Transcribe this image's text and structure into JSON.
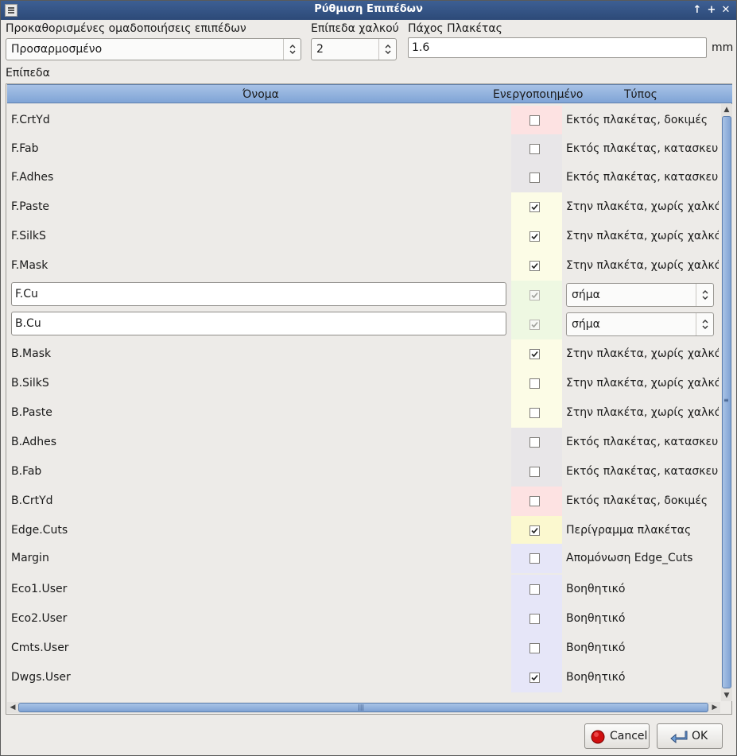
{
  "window": {
    "title": "Ρύθμιση Επιπέδων"
  },
  "presets": {
    "label": "Προκαθορισμένες ομαδοποιήσεις επιπέδων",
    "value": "Προσαρμοσμένο"
  },
  "copper": {
    "label": "Επίπεδα χαλκού",
    "value": "2"
  },
  "thickness": {
    "label": "Πάχος Πλακέτας",
    "value": "1.6",
    "unit": "mm"
  },
  "layers": {
    "label": "Επίπεδα",
    "headers": {
      "name": "Όνομα",
      "enabled": "Ενεργοποιημένο",
      "type": "Τύπος"
    },
    "rows": [
      {
        "name": "F.CrtYd",
        "checked": false,
        "type": "Εκτός πλακέτας, δοκιμές",
        "color": "#fde2e2"
      },
      {
        "name": "F.Fab",
        "checked": false,
        "type": "Εκτός πλακέτας, κατασκευή",
        "color": "#e8e6e8"
      },
      {
        "name": "F.Adhes",
        "checked": false,
        "type": "Εκτός πλακέτας, κατασκευή",
        "color": "#e8e6e8"
      },
      {
        "name": "F.Paste",
        "checked": true,
        "type": "Στην πλακέτα, χωρίς χαλκό",
        "color": "#fcfce6"
      },
      {
        "name": "F.SilkS",
        "checked": true,
        "type": "Στην πλακέτα, χωρίς χαλκό",
        "color": "#fcfce6"
      },
      {
        "name": "F.Mask",
        "checked": true,
        "type": "Στην πλακέτα, χωρίς χαλκό",
        "color": "#fcfce6"
      },
      {
        "name": "F.Cu",
        "checked": true,
        "type": "σήμα",
        "color": "#eef8e2",
        "editable": true
      },
      {
        "name": "B.Cu",
        "checked": true,
        "type": "σήμα",
        "color": "#eef8e2",
        "editable": true
      },
      {
        "name": "B.Mask",
        "checked": true,
        "type": "Στην πλακέτα, χωρίς χαλκό",
        "color": "#fcfce6"
      },
      {
        "name": "B.SilkS",
        "checked": false,
        "type": "Στην πλακέτα, χωρίς χαλκό",
        "color": "#fcfce6"
      },
      {
        "name": "B.Paste",
        "checked": false,
        "type": "Στην πλακέτα, χωρίς χαλκό",
        "color": "#fcfce6"
      },
      {
        "name": "B.Adhes",
        "checked": false,
        "type": "Εκτός πλακέτας, κατασκευή",
        "color": "#e8e6e8"
      },
      {
        "name": "B.Fab",
        "checked": false,
        "type": "Εκτός πλακέτας, κατασκευή",
        "color": "#e8e6e8"
      },
      {
        "name": "B.CrtYd",
        "checked": false,
        "type": "Εκτός πλακέτας, δοκιμές",
        "color": "#fde2e2"
      },
      {
        "name": "Edge.Cuts",
        "checked": true,
        "type": "Περίγραμμα πλακέτας",
        "color": "#fbf8cf"
      },
      {
        "name": "Margin",
        "checked": false,
        "type": "Απομόνωση Edge_Cuts",
        "color": "#e6e6f8"
      },
      {
        "name": "Eco1.User",
        "checked": false,
        "type": "Βοηθητικό",
        "color": "#e6e6f8"
      },
      {
        "name": "Eco2.User",
        "checked": false,
        "type": "Βοηθητικό",
        "color": "#e6e6f8"
      },
      {
        "name": "Cmts.User",
        "checked": false,
        "type": "Βοηθητικό",
        "color": "#e6e6f8"
      },
      {
        "name": "Dwgs.User",
        "checked": true,
        "type": "Βοηθητικό",
        "color": "#e6e6f8"
      }
    ]
  },
  "buttons": {
    "cancel": "Cancel",
    "ok": "OK"
  }
}
